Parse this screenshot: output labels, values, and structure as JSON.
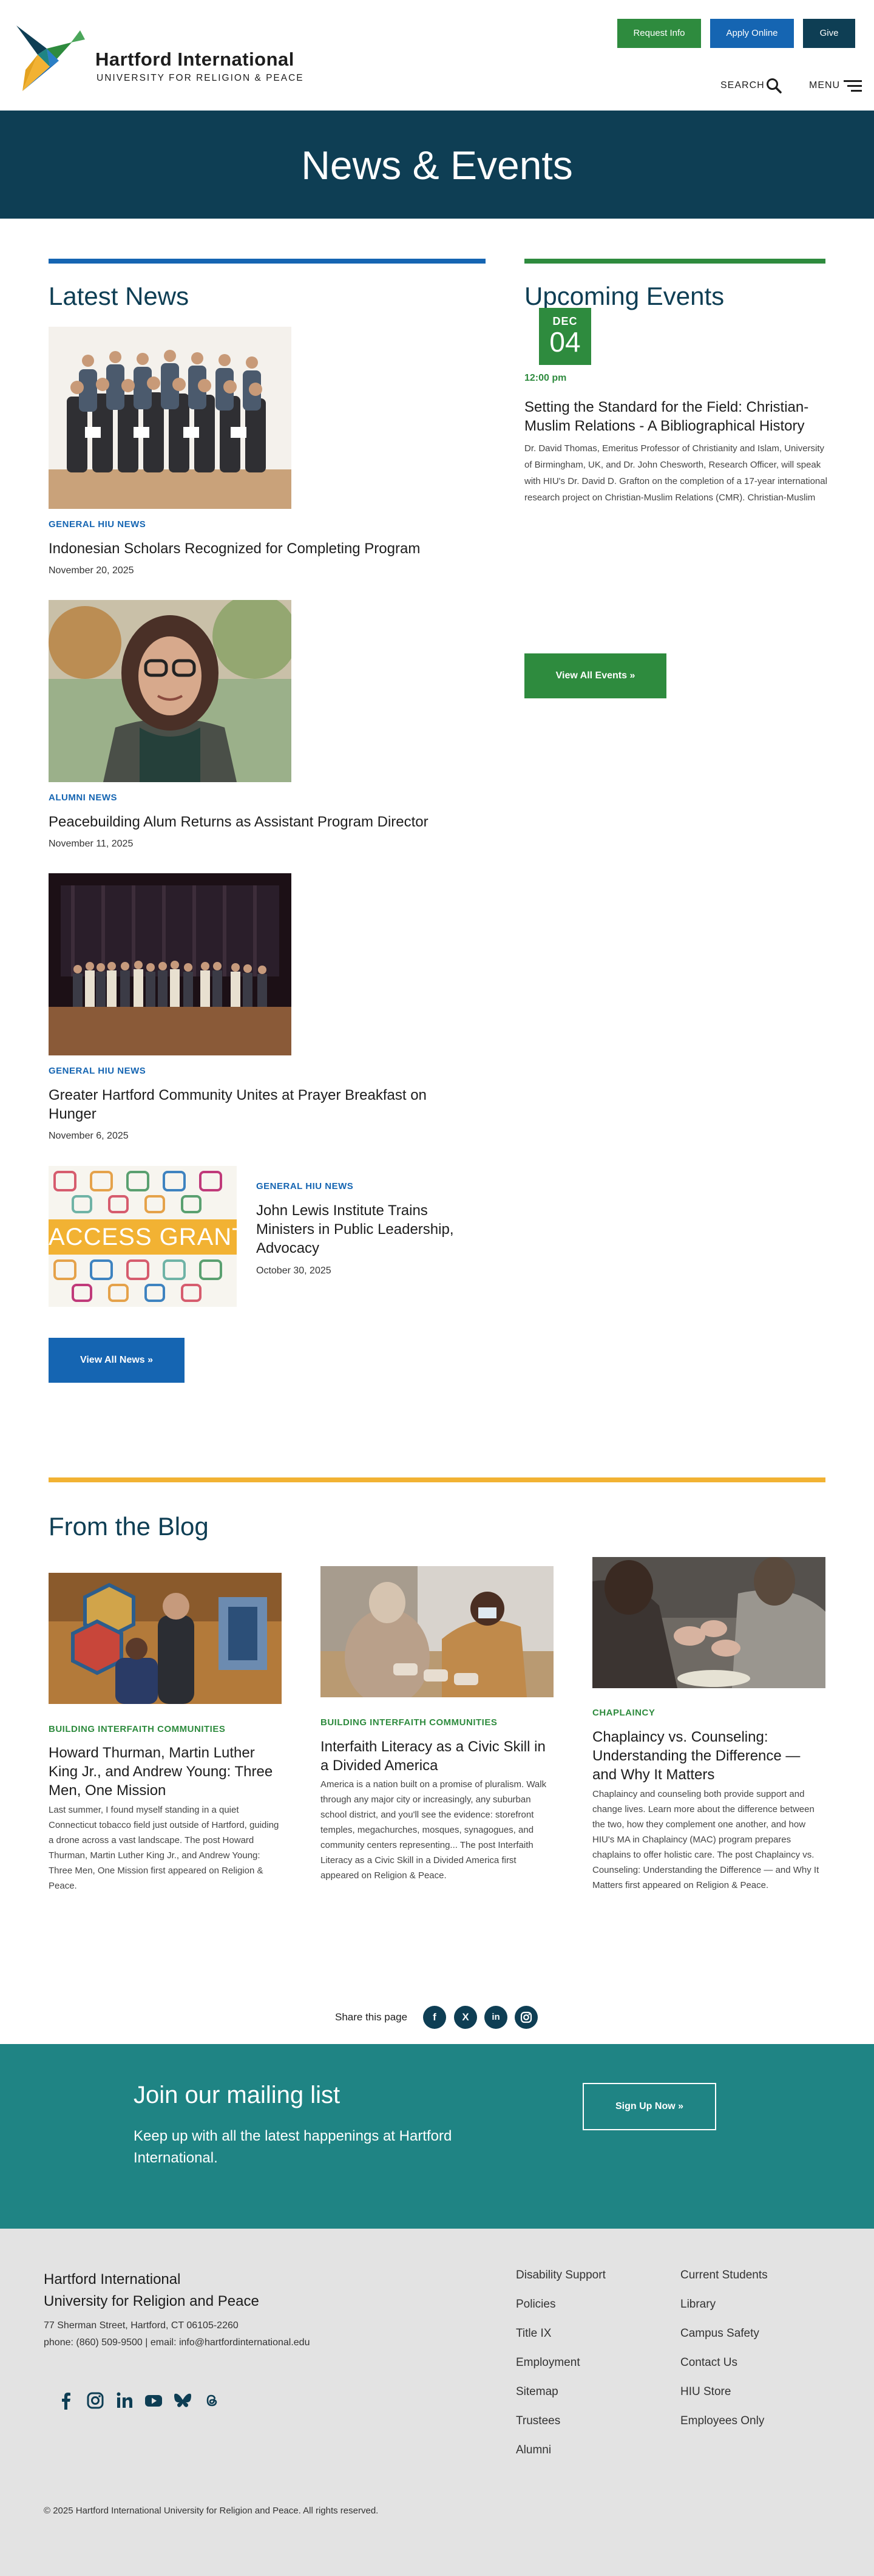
{
  "header": {
    "logo_name": "Hartford International",
    "logo_sub": "UNIVERSITY FOR RELIGION & PEACE",
    "buttons": {
      "request": "Request Info",
      "apply": "Apply Online",
      "give": "Give"
    },
    "search": "SEARCH",
    "menu": "MENU"
  },
  "banner": {
    "title": "News & Events"
  },
  "news": {
    "section_title": "Latest News",
    "items": [
      {
        "category": "GENERAL HIU NEWS",
        "title": "Indonesian Scholars Recognized for Completing Program",
        "date": "November 20, 2025"
      },
      {
        "category": "ALUMNI NEWS",
        "title": "Peacebuilding Alum Returns as Assistant Program Director",
        "date": "November 11, 2025"
      },
      {
        "category": "GENERAL HIU NEWS",
        "title": "Greater Hartford Community Unites at Prayer Breakfast on Hunger",
        "date": "November 6, 2025"
      },
      {
        "category": "GENERAL HIU NEWS",
        "title": "John Lewis Institute Trains Ministers in Public Leadership, Advocacy",
        "date": "October 30, 2025",
        "image_text": "ACCESS GRANT"
      }
    ],
    "view_all": "View All News »"
  },
  "events": {
    "section_title": "Upcoming Events",
    "month": "DEC",
    "day": "04",
    "time": "12:00 pm",
    "title": "Setting the Standard for the Field: Christian-Muslim Relations - A Bibliographical History",
    "description": "Dr. David Thomas, Emeritus Professor of Christianity and Islam, University of Birmingham, UK, and Dr. John Chesworth, Research Officer, will speak with HIU's Dr. David D. Grafton on the completion of a 17-year international research project on Christian-Muslim Relations (CMR). Christian-Muslim",
    "view_all": "View All Events »"
  },
  "blog": {
    "section_title": "From the Blog",
    "items": [
      {
        "category": "BUILDING INTERFAITH COMMUNITIES",
        "title": "Howard Thurman, Martin Luther King Jr., and Andrew Young: Three Men, One Mission",
        "desc": "Last summer, I found myself standing in a quiet Connecticut tobacco field just outside of Hartford, guiding a drone across a vast landscape. The post Howard Thurman, Martin Luther King Jr., and Andrew Young: Three Men, One Mission first appeared on Religion & Peace."
      },
      {
        "category": "BUILDING INTERFAITH COMMUNITIES",
        "title": "Interfaith Literacy as a Civic Skill in a Divided America",
        "desc": "America is a nation built on a promise of pluralism. Walk through any major city or increasingly, any suburban school district, and you'll see the evidence: storefront temples, megachurches, mosques, synagogues, and community centers representing... The post Interfaith Literacy as a Civic Skill in a Divided America first appeared on Religion & Peace."
      },
      {
        "category": "CHAPLAINCY",
        "title": "Chaplaincy vs. Counseling: Understanding the Difference — and Why It Matters",
        "desc": "Chaplaincy and counseling both provide support and change lives. Learn more about the difference between the two, how they complement one another, and how HIU's MA in Chaplaincy (MAC) program prepares chaplains to offer holistic care. The post Chaplaincy vs. Counseling: Understanding the Difference — and Why It Matters first appeared on Religion & Peace."
      }
    ]
  },
  "share": {
    "label": "Share this page",
    "icons": [
      "facebook-icon",
      "x-icon",
      "linkedin-icon",
      "instagram-icon"
    ]
  },
  "mailing": {
    "title": "Join our mailing list",
    "subtitle": "Keep up with all the latest happenings at Hartford International.",
    "button": "Sign Up Now »"
  },
  "footer": {
    "org_line1": "Hartford International",
    "org_line2": "University for Religion and Peace",
    "address": "77 Sherman Street, Hartford, CT 06105-2260",
    "contact": "phone: (860) 509-9500 | email: info@hartfordinternational.edu",
    "links_col1": [
      "Disability Support",
      "Policies",
      "Title IX",
      "Employment",
      "Sitemap",
      "Trustees",
      "Alumni"
    ],
    "links_col2": [
      "Current Students",
      "Library",
      "Campus Safety",
      "Contact Us",
      "HIU Store",
      "Employees Only"
    ],
    "copyright": "© 2025 Hartford International University for Religion and Peace. All rights reserved."
  },
  "colors": {
    "navy": "#0e3e54",
    "blue": "#1565b2",
    "green": "#2e8b3e",
    "teal": "#1f8484",
    "gold": "#f2b233"
  }
}
